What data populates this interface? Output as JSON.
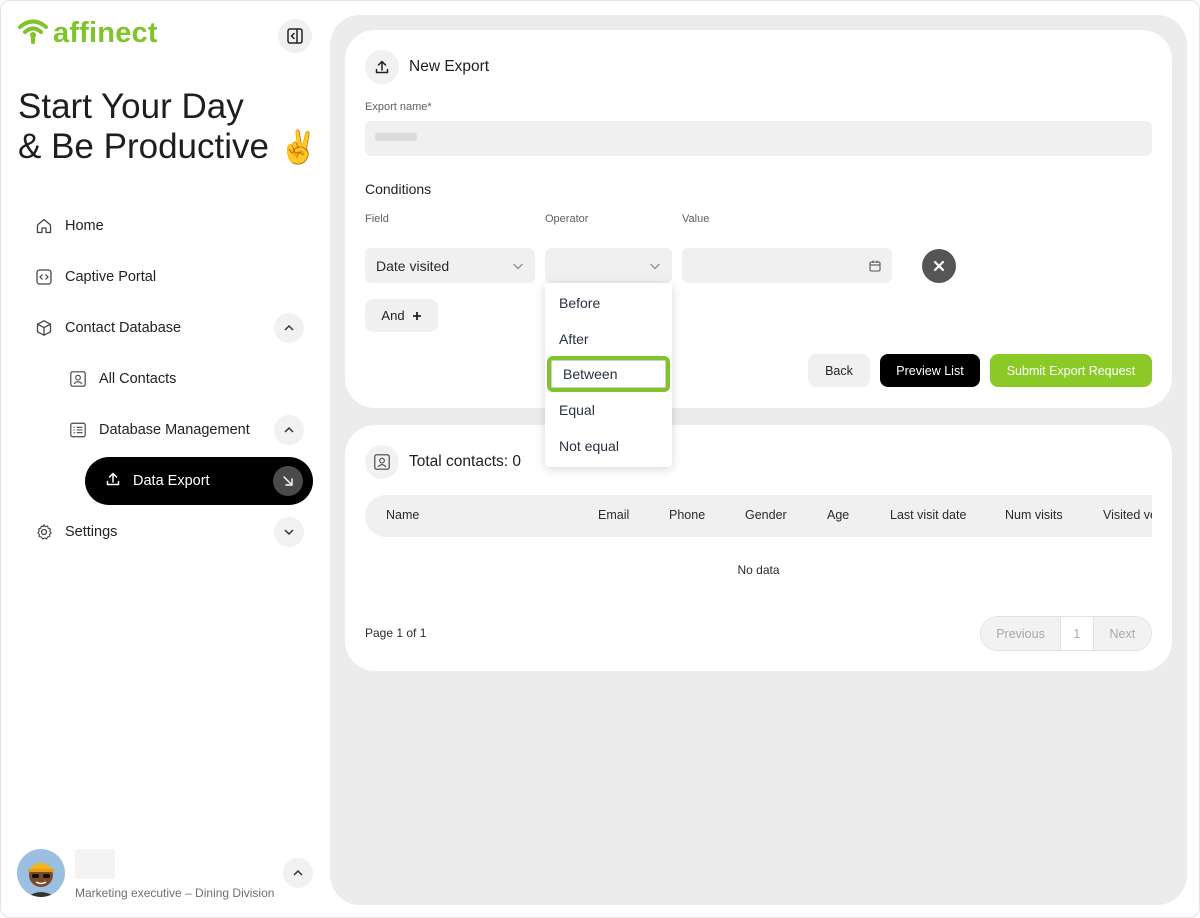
{
  "brand": {
    "name": "affinect",
    "color": "#7ec42a"
  },
  "greeting": {
    "line1": "Start Your Day",
    "line2": "& Be Productive",
    "emoji": "✌️"
  },
  "sidebar": {
    "items": [
      {
        "label": "Home",
        "icon": "home-icon"
      },
      {
        "label": "Captive Portal",
        "icon": "code-icon"
      },
      {
        "label": "Contact Database",
        "icon": "cube-icon"
      },
      {
        "label": "All Contacts",
        "icon": "contact-card-icon"
      },
      {
        "label": "Database Management",
        "icon": "list-icon"
      },
      {
        "label": "Data Export",
        "icon": "upload-icon"
      },
      {
        "label": "Settings",
        "icon": "gear-icon"
      }
    ]
  },
  "user": {
    "role": "Marketing executive – Dining Division"
  },
  "export_form": {
    "title": "New Export",
    "export_name_label": "Export name*",
    "conditions_title": "Conditions",
    "field_label": "Field",
    "operator_label": "Operator",
    "value_label": "Value",
    "field_value": "Date visited",
    "operator_value": "",
    "and_label": "And",
    "back_label": "Back",
    "preview_label": "Preview List",
    "submit_label": "Submit Export Request",
    "operator_options": [
      "Before",
      "After",
      "Between",
      "Equal",
      "Not equal"
    ],
    "highlighted_option": "Between"
  },
  "contacts": {
    "title_prefix": "Total contacts: ",
    "total": "0",
    "columns": [
      "Name",
      "Email",
      "Phone",
      "Gender",
      "Age",
      "Last visit date",
      "Num visits",
      "Visited ve"
    ],
    "empty_text": "No data",
    "page_info": "Page 1 of 1",
    "pager": {
      "previous": "Previous",
      "current": "1",
      "next": "Next"
    }
  }
}
